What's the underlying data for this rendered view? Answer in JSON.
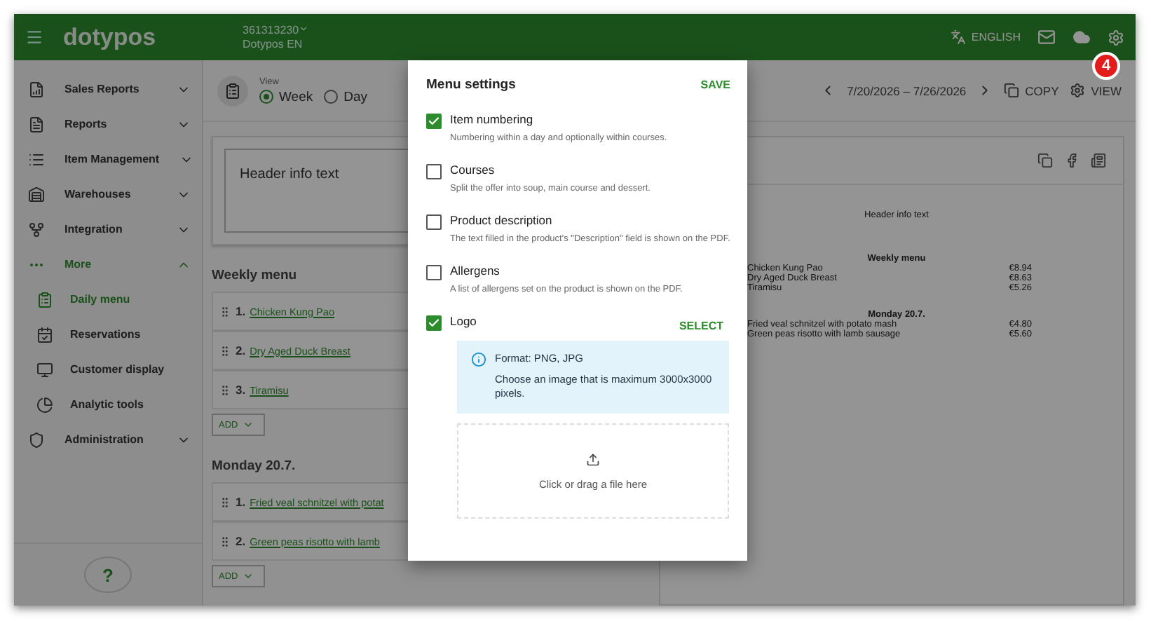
{
  "header": {
    "logo": "dotypos",
    "account_id": "361313230",
    "account_name": "Dotypos EN",
    "language": "ENGLISH"
  },
  "badge": "4",
  "sidebar": {
    "items": [
      {
        "label": "Sales Reports",
        "expanded": false
      },
      {
        "label": "Reports",
        "expanded": false
      },
      {
        "label": "Item Management",
        "expanded": false
      },
      {
        "label": "Warehouses",
        "expanded": false
      },
      {
        "label": "Integration",
        "expanded": false
      },
      {
        "label": "More",
        "expanded": true,
        "children": [
          {
            "label": "Daily menu",
            "selected": true
          },
          {
            "label": "Reservations",
            "selected": false
          },
          {
            "label": "Customer display",
            "selected": false
          },
          {
            "label": "Analytic tools",
            "selected": false
          }
        ]
      },
      {
        "label": "Administration",
        "expanded": false
      }
    ],
    "help": "?"
  },
  "toolbar": {
    "view_label": "View",
    "radios": [
      {
        "label": "Week",
        "selected": true
      },
      {
        "label": "Day",
        "selected": false
      }
    ],
    "date_range": "7/20/2026 – 7/26/2026",
    "copy": "COPY",
    "view": "VIEW"
  },
  "header_info": "Header info text",
  "sections": [
    {
      "title": "Weekly menu",
      "add": "ADD",
      "items": [
        {
          "number": "1.",
          "name": "Chicken Kung Pao"
        },
        {
          "number": "2.",
          "name": "Dry Aged Duck Breast"
        },
        {
          "number": "3.",
          "name": "Tiramisu"
        }
      ]
    },
    {
      "title": "Monday 20.7.",
      "add": "ADD",
      "items": [
        {
          "number": "1.",
          "name": "Fried veal schnitzel with potat"
        },
        {
          "number": "2.",
          "name": "Green peas risotto with lamb"
        }
      ]
    }
  ],
  "preview": {
    "header": "Header info text",
    "sections": [
      {
        "title": "Weekly menu",
        "items": [
          {
            "name": "Chicken Kung Pao",
            "price": "€8.94"
          },
          {
            "name": "Dry Aged Duck Breast",
            "price": "€8.63"
          },
          {
            "name": "Tiramisu",
            "price": "€5.26"
          }
        ]
      },
      {
        "title": "Monday 20.7.",
        "items": [
          {
            "name": "Fried veal schnitzel with potato mash",
            "price": "€4.80"
          },
          {
            "name": "Green peas risotto with lamb sausage",
            "price": "€5.60"
          }
        ]
      }
    ]
  },
  "modal": {
    "title": "Menu settings",
    "save": "SAVE",
    "options": [
      {
        "kind": "option",
        "label": "Item numbering",
        "description": "Numbering within a day and optionally within courses.",
        "checked": true
      },
      {
        "kind": "option",
        "label": "Courses",
        "description": "Split the offer into soup, main course and dessert.",
        "checked": false
      },
      {
        "kind": "option",
        "label": "Product description",
        "description": "The text filled in the product's \"Description\" field is shown on the PDF.",
        "checked": false
      },
      {
        "kind": "option",
        "label": "Allergens",
        "description": "A list of allergens set on the product is shown on the PDF.",
        "checked": false
      },
      {
        "kind": "logo",
        "label": "Logo",
        "action": "SELECT",
        "checked": true
      }
    ],
    "info": {
      "format": "Format: PNG, JPG",
      "text": "Choose an image that is maximum 3000x3000 pixels."
    },
    "upload": "Click or drag a file here"
  }
}
